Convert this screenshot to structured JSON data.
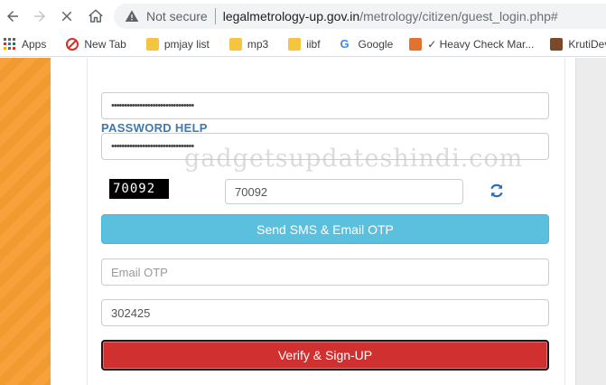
{
  "browser": {
    "not_secure": "Not secure",
    "url_domain": "legalmetrology-up.gov.in",
    "url_path": "/metrology/citizen/guest_login.php#",
    "bookmarks": [
      {
        "label": "Apps",
        "icon": "apps-grid-icon"
      },
      {
        "label": "New Tab",
        "icon": "new-tab-icon"
      },
      {
        "label": "pmjay list",
        "icon": "folder-icon"
      },
      {
        "label": "mp3",
        "icon": "folder-icon"
      },
      {
        "label": "iibf",
        "icon": "folder-icon"
      },
      {
        "label": "Google",
        "icon": "google-icon"
      },
      {
        "label": "✓ Heavy Check Mar...",
        "icon": "site-icon"
      },
      {
        "label": "KrutiDev",
        "icon": "site-icon"
      }
    ]
  },
  "form": {
    "section_title": "PASSWORD HELP",
    "password_mask": "••••••••••••••••••••••••••••••••",
    "confirm_password_mask": "••••••••••••••••••••••••••••••••",
    "captcha_text": "70092",
    "captcha_input_value": "70092",
    "otp_button_label": "Send SMS & Email OTP",
    "email_otp_placeholder": "Email OTP",
    "sms_otp_value": "302425",
    "verify_button_label": "Verify & Sign-UP"
  },
  "watermark": "gadgetsupdateshindi.com",
  "colors": {
    "stripe_orange": "#f7a13a",
    "section_title_blue": "#3d79b5",
    "otp_button_bg": "#5bc0de",
    "verify_button_bg": "#d03030"
  }
}
